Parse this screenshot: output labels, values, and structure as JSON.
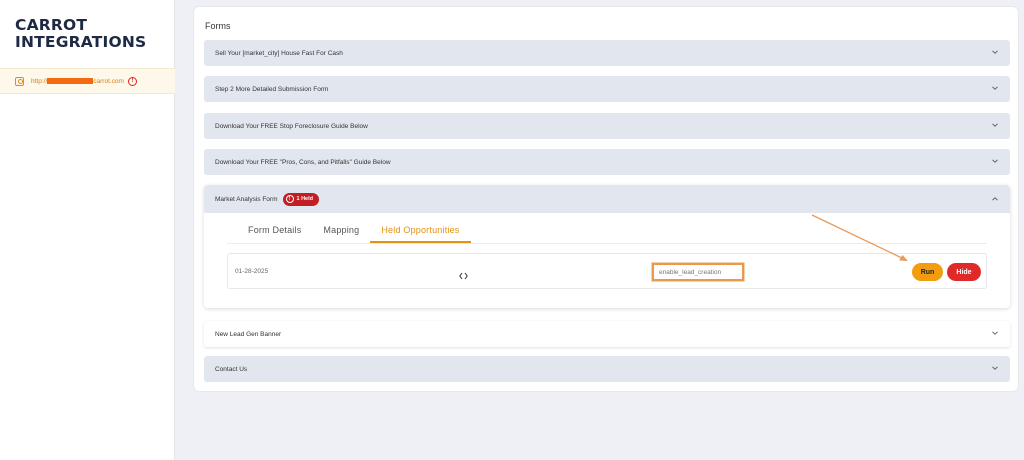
{
  "sidebar": {
    "brand_line1": "CARROT",
    "brand_line2": "INTEGRATIONS",
    "site_url_prefix": "http://",
    "site_url_suffix": "carrot.com",
    "warn_glyph": "!"
  },
  "main": {
    "title": "Forms",
    "forms": [
      {
        "label": "Sell Your [market_city] House Fast For Cash"
      },
      {
        "label": "Step 2 More Detailed Submission Form"
      },
      {
        "label": "Download Your FREE Stop Foreclosure Guide Below"
      },
      {
        "label": "Download Your FREE \"Pros, Cons, and Pitfalls\" Guide Below"
      }
    ],
    "expanded": {
      "label": "Market Analysis Form",
      "badge": "1 Held",
      "badge_glyph": "!",
      "tabs": [
        "Form Details",
        "Mapping",
        "Held Opportunities"
      ],
      "active_tab": "Held Opportunities",
      "row": {
        "date": "01-28-2025",
        "field_value": "enable_lead_creation",
        "run_label": "Run",
        "hide_label": "Hide"
      }
    },
    "after_forms": [
      {
        "label": "New Lead Gen Banner"
      },
      {
        "label": "Contact Us"
      }
    ]
  },
  "colors": {
    "accent": "#e5900f",
    "run": "#f29c10",
    "hide": "#e02a2a",
    "badge": "#c41e25",
    "brand": "#1e2a44"
  }
}
